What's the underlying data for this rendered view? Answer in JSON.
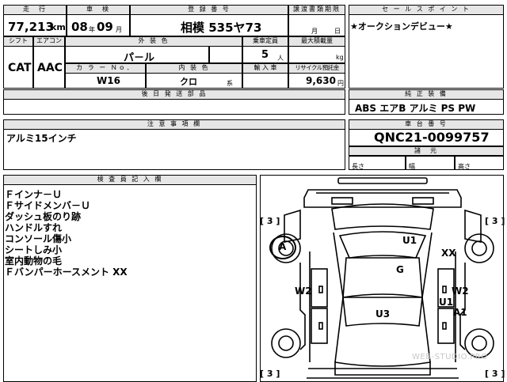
{
  "header": {
    "mileage_label": "走　行",
    "inspection_label": "車　検",
    "reg_label": "登 録 番 号",
    "transfer_label": "譲渡書類期限",
    "sales_point_label": "セ ー ル ス ポ イ ン ト",
    "mileage": "77,213",
    "mileage_unit": "km",
    "inspection_year": "08",
    "year_unit": "年",
    "inspection_month": "09",
    "month_unit": "月",
    "registration": "相模 535ヤ73",
    "transfer_month_unit": "月",
    "transfer_day_unit": "日",
    "sales_point": "★オークションデビュー★"
  },
  "specs": {
    "shift_label": "シフト",
    "ac_label": "エアコン",
    "ext_color_label": "外 装 色",
    "capacity_label": "乗車定員",
    "load_label": "最大積載量",
    "shift": "CAT",
    "ac": "AAC",
    "ext_color": "パ－ル",
    "capacity": "5",
    "capacity_unit": "人",
    "load_unit": "kg",
    "color_no_label": "カ ラ ー Ｎｏ．",
    "int_color_label": "内 装 色",
    "import_label": "輸 入 車",
    "recycle_label": "リサイクル預託金",
    "color_no": "W16",
    "int_color": "クロ",
    "int_suffix": "系",
    "recycle": "9,630",
    "recycle_unit": "円"
  },
  "options": {
    "later_label": "後 日 発 送 部 品",
    "equip_label": "純 正 装 備",
    "equipment": "ABS エアB アルミ PS PW"
  },
  "notes": {
    "label": "注 意 事 項 欄",
    "text": "アルミ15インチ"
  },
  "chassis": {
    "label": "車 台 番 号",
    "number": "QNC21-0099757",
    "dims_label": "諸　元",
    "length": "長さ",
    "width": "幅",
    "height": "高さ"
  },
  "inspector": {
    "label": "検 査 員 記 入 欄",
    "remarks": [
      "Ｆインナ－Ｕ",
      "Ｆサイドメンバ－Ｕ",
      "ダッシュ板のり跡",
      "ハンドルすれ",
      "コンソール傷小",
      "シートしみ小",
      "室内動物の毛",
      "Ｆバンパーホースメント XX"
    ]
  },
  "diagram": {
    "tread_marks": [
      "[ 3 ]",
      "[ 3 ]",
      "[ 3 ]",
      "[ 3 ]"
    ],
    "marks": {
      "a_circle": "A",
      "u1_top": "U1",
      "xx": "XX",
      "g": "G",
      "w2_left": "W2",
      "w2_right": "W2",
      "u1_right": "U1",
      "u3": "U3",
      "a1": "A1"
    },
    "watermark": "WEB-STUDIO.PRO"
  }
}
